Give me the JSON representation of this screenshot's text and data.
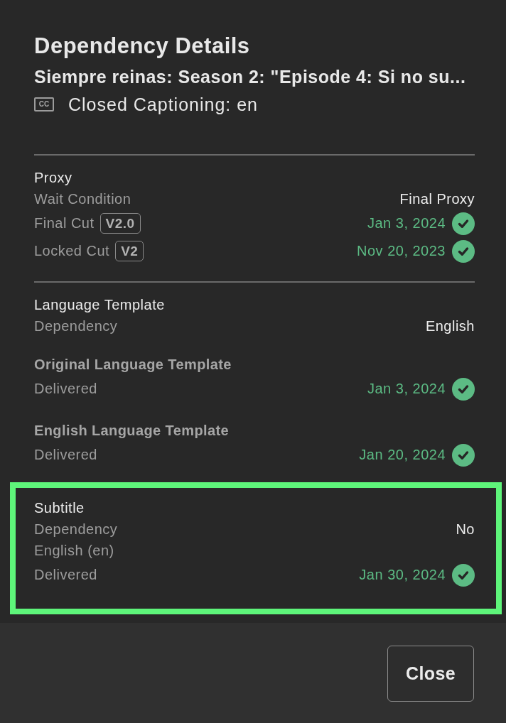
{
  "dialog": {
    "title": "Dependency Details",
    "subtitle": "Siempre reinas: Season 2: \"Episode 4: Si no su...",
    "asset": {
      "badge": "CC",
      "label": "Closed Captioning: en"
    }
  },
  "sections": [
    {
      "heading": "Proxy",
      "divider_above": true,
      "highlighted": false,
      "rows": [
        {
          "kind": "value",
          "label": "Wait Condition",
          "value": "Final Proxy"
        },
        {
          "kind": "date",
          "label": "Final Cut",
          "badge": "V2.0",
          "value": "Jan 3, 2024"
        },
        {
          "kind": "date",
          "label": "Locked Cut",
          "badge": "V2",
          "value": "Nov 20, 2023"
        }
      ]
    },
    {
      "heading": "Language Template",
      "divider_above": true,
      "highlighted": false,
      "rows": [
        {
          "kind": "value",
          "label": "Dependency",
          "value": "English"
        },
        {
          "kind": "subheading",
          "label": "Original Language Template"
        },
        {
          "kind": "date",
          "label": "Delivered",
          "value": "Jan 3, 2024"
        },
        {
          "kind": "subheading",
          "label": "English Language Template"
        },
        {
          "kind": "date",
          "label": "Delivered",
          "value": "Jan 20, 2024"
        }
      ]
    },
    {
      "heading": "Subtitle",
      "divider_above": false,
      "highlighted": true,
      "rows": [
        {
          "kind": "value",
          "label": "Dependency",
          "value": "No"
        },
        {
          "kind": "value",
          "label": "English (en)"
        },
        {
          "kind": "date",
          "label": "Delivered",
          "value": "Jan 30, 2024"
        }
      ]
    }
  ],
  "buttons": [
    {
      "label": "Close"
    }
  ]
}
